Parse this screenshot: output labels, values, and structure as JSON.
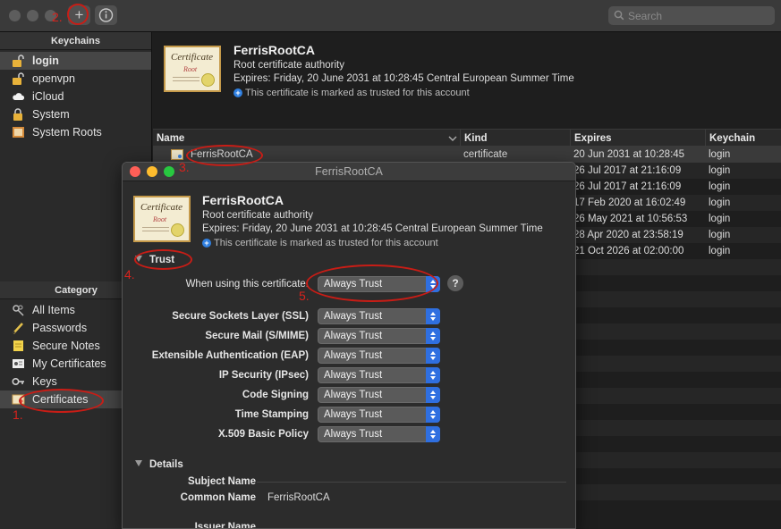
{
  "toolbar": {
    "add_label": "+",
    "info_label": "i",
    "search_placeholder": "Search"
  },
  "sidebar": {
    "keychains_header": "Keychains",
    "keychains": [
      {
        "label": "login",
        "icon": "lock-open-icon"
      },
      {
        "label": "openvpn",
        "icon": "lock-open-icon"
      },
      {
        "label": "iCloud",
        "icon": "cloud-icon"
      },
      {
        "label": "System",
        "icon": "lock-icon"
      },
      {
        "label": "System Roots",
        "icon": "cabinet-icon"
      }
    ],
    "category_header": "Category",
    "categories": [
      {
        "label": "All Items",
        "icon": "all-items-icon"
      },
      {
        "label": "Passwords",
        "icon": "password-icon"
      },
      {
        "label": "Secure Notes",
        "icon": "note-icon"
      },
      {
        "label": "My Certificates",
        "icon": "my-certificates-icon"
      },
      {
        "label": "Keys",
        "icon": "key-icon"
      },
      {
        "label": "Certificates",
        "icon": "certificate-icon"
      }
    ]
  },
  "info": {
    "name": "FerrisRootCA",
    "kind": "Root certificate authority",
    "expires": "Expires: Friday, 20 June 2031 at 10:28:45 Central European Summer Time",
    "trusted": "This certificate is marked as trusted for this account",
    "cert_image_title": "Certificate",
    "cert_image_sub": "Root"
  },
  "table": {
    "columns": [
      "Name",
      "Kind",
      "Expires",
      "Keychain"
    ],
    "rows": [
      {
        "name": "FerrisRootCA",
        "kind": "certificate",
        "expires": "20 Jun 2031 at 10:28:45",
        "keychain": "login"
      },
      {
        "name": "",
        "kind": "",
        "expires": "26 Jul 2017 at 21:16:09",
        "keychain": "login"
      },
      {
        "name": "",
        "kind": "",
        "expires": "26 Jul 2017 at 21:16:09",
        "keychain": "login"
      },
      {
        "name": "",
        "kind": "",
        "expires": "17 Feb 2020 at 16:02:49",
        "keychain": "login"
      },
      {
        "name": "",
        "kind": "",
        "expires": "26 May 2021 at 10:56:53",
        "keychain": "login"
      },
      {
        "name": "",
        "kind": "",
        "expires": "28 Apr 2020 at 23:58:19",
        "keychain": "login"
      },
      {
        "name": "",
        "kind": "",
        "expires": "21 Oct 2026 at 02:00:00",
        "keychain": "login"
      }
    ]
  },
  "dialog": {
    "title": "FerrisRootCA",
    "trust_label": "Trust",
    "when_using_label": "When using this certificate:",
    "when_using_value": "Always Trust",
    "help_label": "?",
    "policies": [
      {
        "label": "Secure Sockets Layer (SSL)",
        "value": "Always Trust"
      },
      {
        "label": "Secure Mail (S/MIME)",
        "value": "Always Trust"
      },
      {
        "label": "Extensible Authentication (EAP)",
        "value": "Always Trust"
      },
      {
        "label": "IP Security (IPsec)",
        "value": "Always Trust"
      },
      {
        "label": "Code Signing",
        "value": "Always Trust"
      },
      {
        "label": "Time Stamping",
        "value": "Always Trust"
      },
      {
        "label": "X.509 Basic Policy",
        "value": "Always Trust"
      }
    ],
    "details_label": "Details",
    "subject_name_label": "Subject Name",
    "common_name_label": "Common Name",
    "common_name_value": "FerrisRootCA",
    "issuer_name_label": "Issuer Name"
  },
  "annotations": {
    "step1": "1.",
    "step2": "2.",
    "step3": "3.",
    "step4": "4.",
    "step5": "5."
  },
  "colors": {
    "annotation_red": "#d8231d",
    "popup_blue": "#2f6fe0",
    "close_red": "#ff5f57",
    "minimize_yellow": "#febc2e",
    "zoom_green": "#28c840"
  }
}
